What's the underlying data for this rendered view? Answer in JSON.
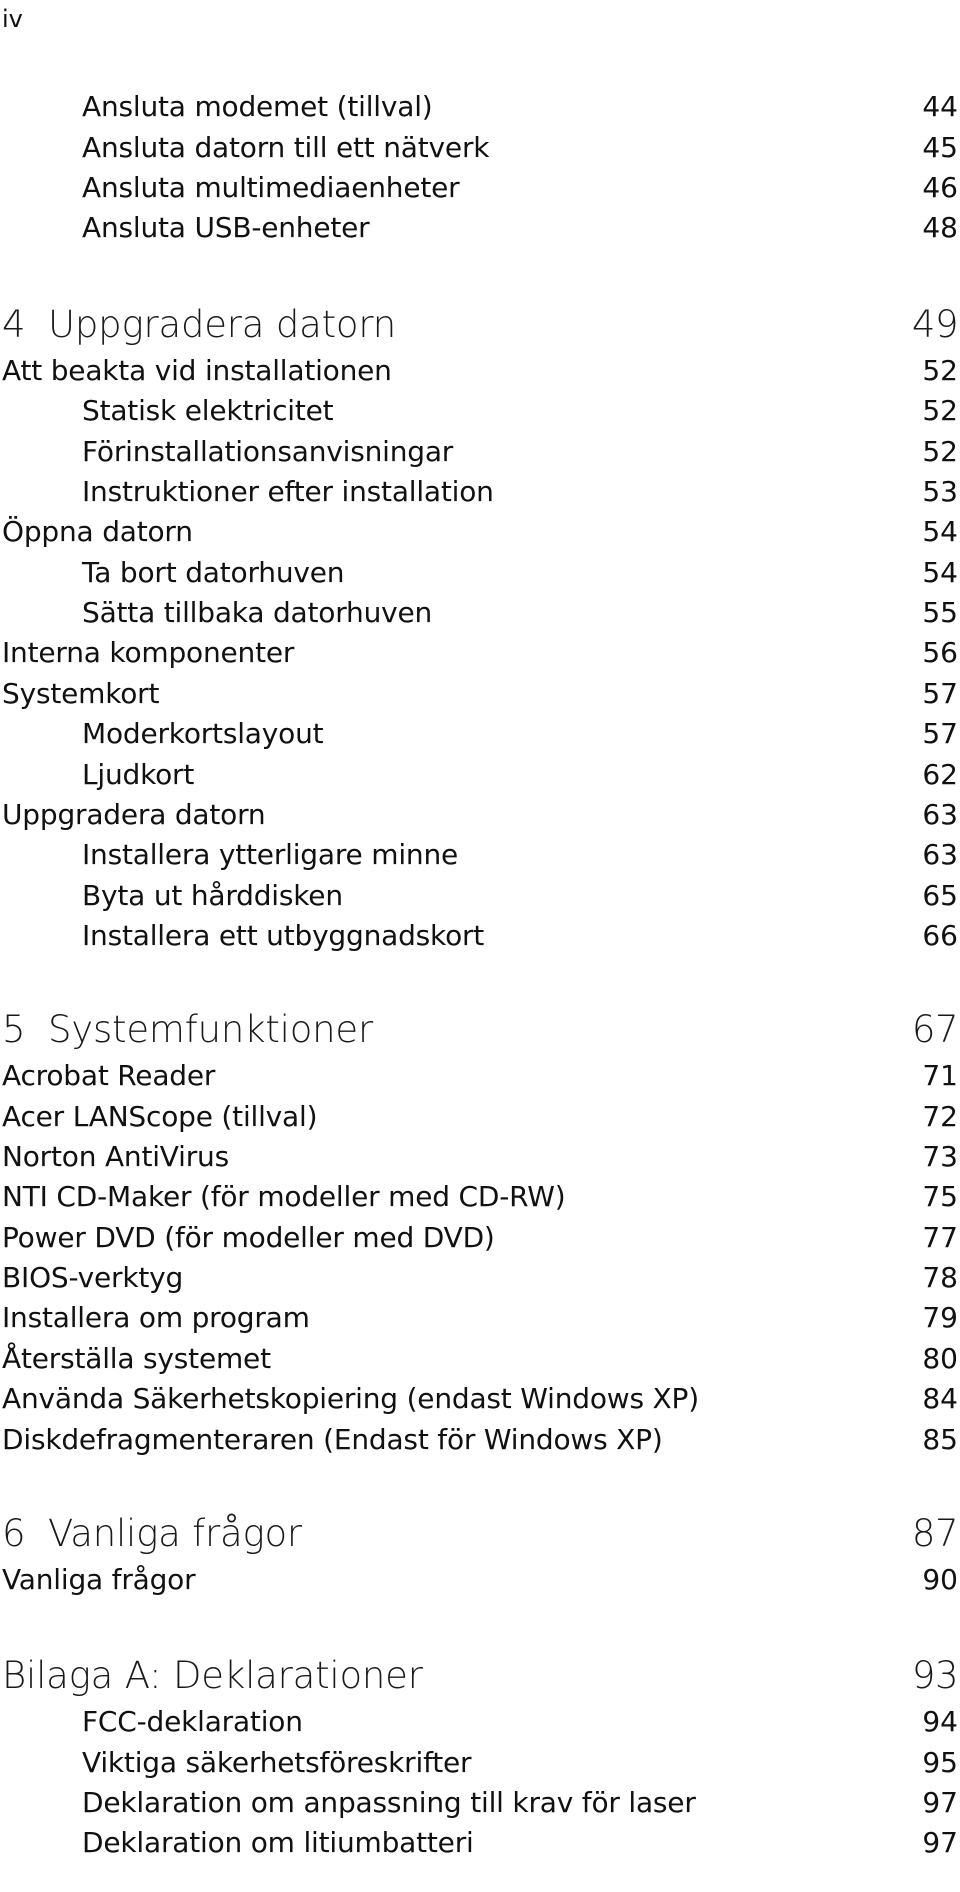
{
  "page_number": "iv",
  "entries": [
    {
      "level": 2,
      "title": "Ansluta modemet (tillval)",
      "page": "44"
    },
    {
      "level": 2,
      "title": "Ansluta datorn till ett nätverk",
      "page": "45"
    },
    {
      "level": 2,
      "title": "Ansluta multimediaenheter",
      "page": "46"
    },
    {
      "level": 2,
      "title": "Ansluta USB-enheter",
      "page": "48"
    },
    {
      "level": 0,
      "number": "4",
      "title": "Uppgradera datorn",
      "page": "49"
    },
    {
      "level": 1,
      "title": "Att beakta vid installationen",
      "page": "52"
    },
    {
      "level": 2,
      "title": "Statisk elektricitet",
      "page": "52"
    },
    {
      "level": 2,
      "title": "Förinstallationsanvisningar",
      "page": "52"
    },
    {
      "level": 2,
      "title": "Instruktioner efter installation",
      "page": "53"
    },
    {
      "level": 1,
      "title": "Öppna datorn",
      "page": "54"
    },
    {
      "level": 2,
      "title": "Ta bort datorhuven",
      "page": "54"
    },
    {
      "level": 2,
      "title": "Sätta tillbaka datorhuven",
      "page": "55"
    },
    {
      "level": 1,
      "title": "Interna komponenter",
      "page": "56"
    },
    {
      "level": 1,
      "title": "Systemkort",
      "page": "57"
    },
    {
      "level": 2,
      "title": "Moderkortslayout",
      "page": "57"
    },
    {
      "level": 2,
      "title": "Ljudkort",
      "page": "62"
    },
    {
      "level": 1,
      "title": "Uppgradera datorn",
      "page": "63"
    },
    {
      "level": 2,
      "title": "Installera ytterligare minne",
      "page": "63"
    },
    {
      "level": 2,
      "title": "Byta ut hårddisken",
      "page": "65"
    },
    {
      "level": 2,
      "title": "Installera ett utbyggnadskort",
      "page": "66"
    },
    {
      "level": 0,
      "number": "5",
      "title": "Systemfunktioner",
      "page": "67"
    },
    {
      "level": 1,
      "title": "Acrobat Reader",
      "page": "71"
    },
    {
      "level": 1,
      "title": "Acer LANScope (tillval)",
      "page": "72"
    },
    {
      "level": 1,
      "title": "Norton AntiVirus",
      "page": "73"
    },
    {
      "level": 1,
      "title": "NTI CD-Maker (för modeller med CD-RW)",
      "page": "75"
    },
    {
      "level": 1,
      "title": "Power DVD (för modeller med DVD)",
      "page": "77"
    },
    {
      "level": 1,
      "title": "BIOS-verktyg",
      "page": "78"
    },
    {
      "level": 1,
      "title": "Installera om program",
      "page": "79"
    },
    {
      "level": 1,
      "title": "Återställa systemet",
      "page": "80"
    },
    {
      "level": 1,
      "title": "Använda Säkerhetskopiering (endast Windows XP)",
      "page": "84"
    },
    {
      "level": 1,
      "title": "Diskdefragmenteraren (Endast för Windows XP)",
      "page": "85"
    },
    {
      "level": 0,
      "number": "6",
      "title": "Vanliga frågor",
      "page": "87"
    },
    {
      "level": 1,
      "title": "Vanliga frågor",
      "page": "90"
    },
    {
      "level": 0,
      "number": "",
      "title": "Bilaga A: Deklarationer",
      "page": "93"
    },
    {
      "level": 2,
      "title": "FCC-deklaration",
      "page": "94"
    },
    {
      "level": 2,
      "title": "Viktiga säkerhetsföreskrifter",
      "page": "95"
    },
    {
      "level": 2,
      "title": "Deklaration om anpassning till krav för laser",
      "page": "97"
    },
    {
      "level": 2,
      "title": "Deklaration om litiumbatteri",
      "page": "97"
    }
  ]
}
